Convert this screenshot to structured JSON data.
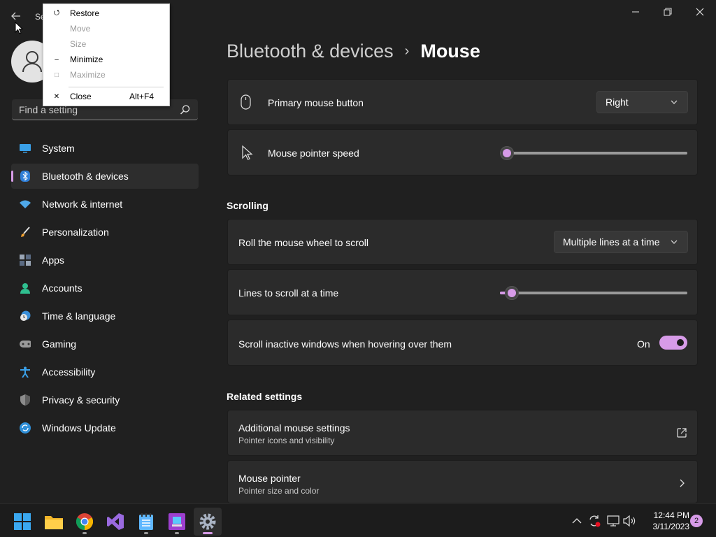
{
  "window": {
    "title": "Se",
    "controls": [
      "minimize-icon",
      "restore-icon",
      "close-icon"
    ]
  },
  "context_menu": {
    "items": [
      {
        "label": "Restore",
        "icon": "restore-icon",
        "enabled": true
      },
      {
        "label": "Move",
        "icon": "",
        "enabled": false
      },
      {
        "label": "Size",
        "icon": "",
        "enabled": false
      },
      {
        "label": "Minimize",
        "icon": "minimize-icon",
        "enabled": true
      },
      {
        "label": "Maximize",
        "icon": "maximize-icon",
        "enabled": false
      },
      {
        "label": "Close",
        "icon": "close-icon",
        "enabled": true,
        "shortcut": "Alt+F4"
      }
    ]
  },
  "search": {
    "placeholder": "Find a setting"
  },
  "sidebar": {
    "items": [
      {
        "label": "System",
        "icon": "system-icon"
      },
      {
        "label": "Bluetooth & devices",
        "icon": "bluetooth-icon",
        "active": true
      },
      {
        "label": "Network & internet",
        "icon": "wifi-icon"
      },
      {
        "label": "Personalization",
        "icon": "brush-icon"
      },
      {
        "label": "Apps",
        "icon": "apps-icon"
      },
      {
        "label": "Accounts",
        "icon": "accounts-icon"
      },
      {
        "label": "Time & language",
        "icon": "clock-globe-icon"
      },
      {
        "label": "Gaming",
        "icon": "gamepad-icon"
      },
      {
        "label": "Accessibility",
        "icon": "accessibility-icon"
      },
      {
        "label": "Privacy & security",
        "icon": "shield-icon"
      },
      {
        "label": "Windows Update",
        "icon": "update-icon"
      }
    ]
  },
  "header": {
    "parent": "Bluetooth & devices",
    "separator": "›",
    "current": "Mouse"
  },
  "settings": {
    "primary_button": {
      "label": "Primary mouse button",
      "value": "Right"
    },
    "pointer_speed": {
      "label": "Mouse pointer speed",
      "level": 0.0
    },
    "scrolling_title": "Scrolling",
    "roll_wheel": {
      "label": "Roll the mouse wheel to scroll",
      "value": "Multiple lines at a time"
    },
    "lines_to_scroll": {
      "label": "Lines to scroll at a time",
      "level": 0.03
    },
    "scroll_inactive": {
      "label": "Scroll inactive windows when hovering over them",
      "state": "On"
    },
    "related_title": "Related settings",
    "additional_mouse": {
      "label": "Additional mouse settings",
      "sub": "Pointer icons and visibility"
    },
    "mouse_pointer": {
      "label": "Mouse pointer",
      "sub": "Pointer size and color"
    }
  },
  "taskbar": {
    "apps": [
      "start-icon",
      "file-explorer-icon",
      "chrome-icon",
      "visual-studio-icon",
      "notepad-icon",
      "app-icon",
      "settings-icon"
    ],
    "tray": [
      "chevron-up-icon",
      "sync-icon",
      "display-icon",
      "volume-icon"
    ],
    "time": "12:44 PM",
    "date": "3/11/2023",
    "notifications": "2"
  },
  "colors": {
    "accent": "#d79be8",
    "background": "#202020",
    "card": "#2b2b2b"
  }
}
